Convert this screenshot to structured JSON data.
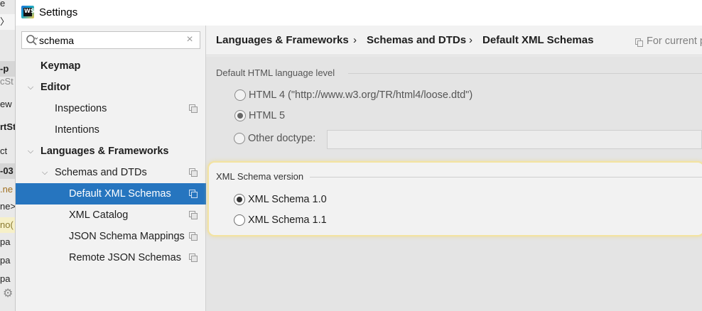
{
  "background_window": {
    "fragments": [
      "e",
      "",
      "-p",
      "cSt",
      "ew",
      "rtSt",
      "ct",
      "-03",
      ".ne",
      "ne>",
      "no(",
      "pa",
      "pa",
      "pa"
    ]
  },
  "window": {
    "title": "Settings",
    "app_icon_text": "WS"
  },
  "search": {
    "value": "schema",
    "clear_glyph": "×"
  },
  "tree": [
    {
      "label": "Keymap",
      "level": 0,
      "bold": true
    },
    {
      "label": "Editor",
      "level": 0,
      "bold": true,
      "expanded": true
    },
    {
      "label": "Inspections",
      "level": 1,
      "copy_icon": true
    },
    {
      "label": "Intentions",
      "level": 1
    },
    {
      "label": "Languages & Frameworks",
      "level": 0,
      "bold": true,
      "expanded": true
    },
    {
      "label": "Schemas and DTDs",
      "level": 1,
      "expanded": true,
      "copy_icon": true
    },
    {
      "label": "Default XML Schemas",
      "level": 2,
      "selected": true,
      "copy_icon": true
    },
    {
      "label": "XML Catalog",
      "level": 2,
      "copy_icon": true
    },
    {
      "label": "JSON Schema Mappings",
      "level": 2,
      "copy_icon": true
    },
    {
      "label": "Remote JSON Schemas",
      "level": 2,
      "copy_icon": true
    }
  ],
  "breadcrumb": {
    "items": [
      "Languages & Frameworks",
      "Schemas and DTDs",
      "Default XML Schemas"
    ],
    "separator": "›",
    "scope_label": "For current p"
  },
  "html_level": {
    "title": "Default HTML language level",
    "options": [
      {
        "label": "HTML 4 (\"http://www.w3.org/TR/html4/loose.dtd\")",
        "checked": false
      },
      {
        "label": "HTML 5",
        "checked": true
      },
      {
        "label": "Other doctype:",
        "checked": false
      }
    ],
    "other_doctype_value": ""
  },
  "xml_schema": {
    "title": "XML Schema version",
    "options": [
      {
        "label": "XML Schema 1.0",
        "checked": true
      },
      {
        "label": "XML Schema 1.1",
        "checked": false
      }
    ]
  },
  "colors": {
    "selection": "#2675bf",
    "highlight_border": "#f3e3a1",
    "content_bg": "#e4e4e4"
  }
}
